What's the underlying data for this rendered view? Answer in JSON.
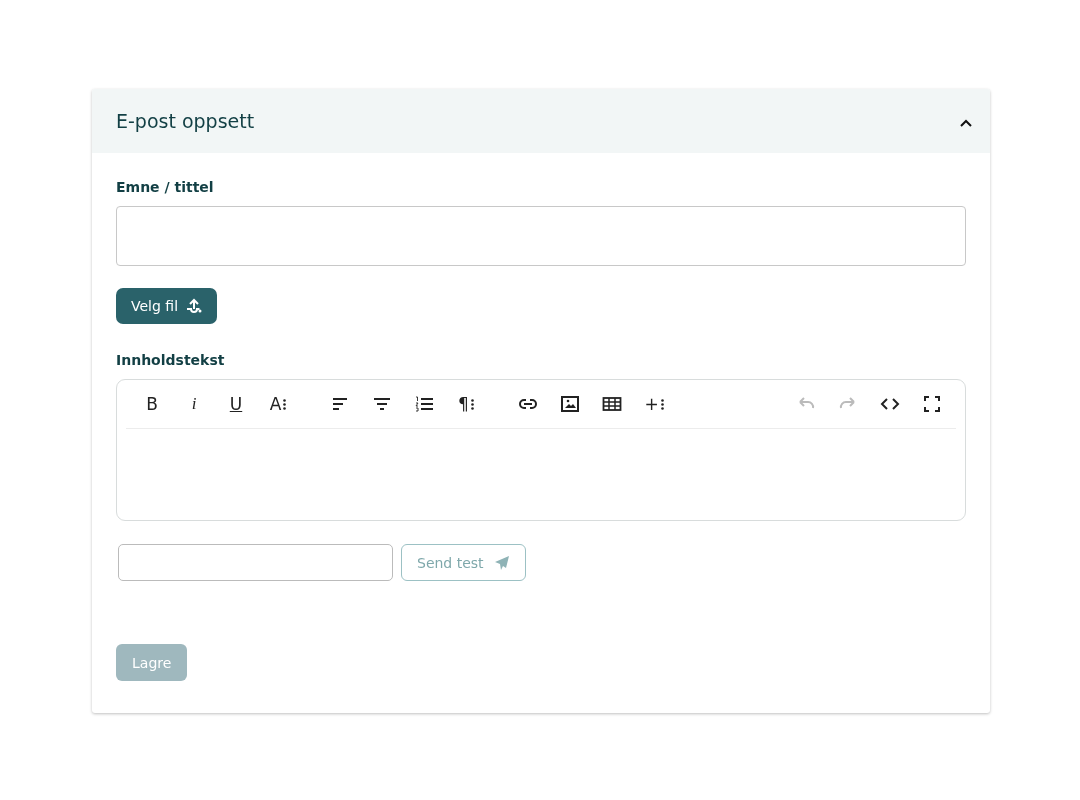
{
  "panel": {
    "title": "E-post oppsett",
    "expanded": true
  },
  "subject": {
    "label": "Emne / tittel"
  },
  "file_button": {
    "label": "Velg fil"
  },
  "content": {
    "label": "Innholdstekst",
    "toolbar": [
      {
        "items": [
          {
            "kind": "bold",
            "label": "B",
            "disabled": false
          },
          {
            "kind": "italic",
            "label": "i",
            "disabled": false
          },
          {
            "kind": "underline",
            "label": "U",
            "disabled": false
          },
          {
            "kind": "font-size",
            "label": "A",
            "disabled": false
          }
        ]
      },
      {
        "items": [
          {
            "kind": "align-left",
            "disabled": false
          },
          {
            "kind": "align-center",
            "disabled": false
          },
          {
            "kind": "ordered-list",
            "disabled": false
          },
          {
            "kind": "paragraph",
            "label": "¶",
            "disabled": false
          }
        ]
      },
      {
        "items": [
          {
            "kind": "link",
            "disabled": false
          },
          {
            "kind": "image",
            "disabled": false
          },
          {
            "kind": "table",
            "disabled": false
          },
          {
            "kind": "insert",
            "label": "+",
            "disabled": false
          }
        ]
      },
      {
        "items": [
          {
            "kind": "undo",
            "disabled": true
          },
          {
            "kind": "redo",
            "disabled": true
          },
          {
            "kind": "code",
            "disabled": false
          },
          {
            "kind": "fullscreen",
            "disabled": false
          }
        ]
      }
    ]
  },
  "test": {
    "button": "Send test",
    "disabled": true
  },
  "save_button": {
    "label": "Lagre",
    "disabled": true
  }
}
